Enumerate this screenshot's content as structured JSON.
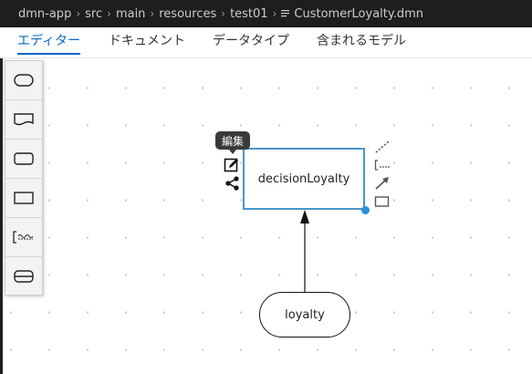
{
  "breadcrumb": {
    "items": [
      "dmn-app",
      "src",
      "main",
      "resources",
      "test01"
    ],
    "file": "CustomerLoyalty.dmn"
  },
  "tabs": [
    {
      "label": "エディター",
      "active": true
    },
    {
      "label": "ドキュメント",
      "active": false
    },
    {
      "label": "データタイプ",
      "active": false
    },
    {
      "label": "含まれるモデル",
      "active": false
    }
  ],
  "palette": {
    "items": [
      "decision-tool",
      "knowledge-source-tool",
      "input-data-tool",
      "bkm-tool",
      "annotation-tool",
      "decision-service-tool"
    ]
  },
  "diagram": {
    "decision_node": {
      "label": "decisionLoyalty"
    },
    "input_node": {
      "label": "loyalty"
    },
    "tooltip": "編集"
  },
  "colors": {
    "accent": "#0066cc",
    "selection": "#4a95c9",
    "handle": "#2f8fd8",
    "breadcrumb_bg": "#1e1e1e"
  }
}
